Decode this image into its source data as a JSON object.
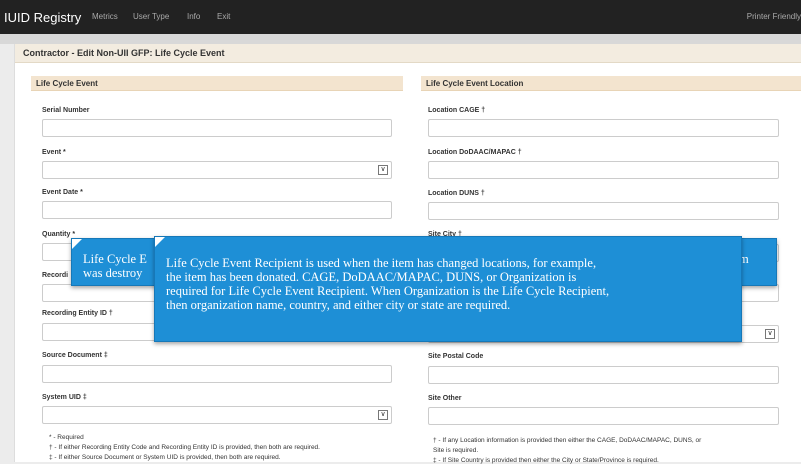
{
  "nav": {
    "brand": "IUID Registry",
    "items": [
      "Metrics",
      "User Type",
      "Info",
      "Exit"
    ],
    "printer": "Printer Friendly"
  },
  "page_title": "Contractor - Edit Non-UII GFP: Life Cycle Event",
  "left": {
    "title": "Life Cycle Event",
    "labels": {
      "serial": "Serial Number",
      "event": "Event *",
      "event_date": "Event Date *",
      "quantity": "Quantity *",
      "recording_code": "Recordi",
      "recording_id": "Recording Entity ID †",
      "source_doc": "Source Document ‡",
      "system_uid": "System UID ‡"
    },
    "notes": [
      "* - Required",
      "† - If either Recording Entity Code and Recording Entity ID is provided, then both are required.",
      "‡ - If either Source Document or System UID is provided, then both are required."
    ]
  },
  "right": {
    "title": "Life Cycle Event Location",
    "labels": {
      "cage": "Location CAGE †",
      "dodaac": "Location DoDAAC/MAPAC †",
      "duns": "Location DUNS †",
      "city": "Site City †",
      "postal": "Site Postal Code",
      "other": "Site Other"
    },
    "notes": [
      "† - If any Location information is provided then either the CAGE, DoDAAC/MAPAC, DUNS, or",
      "Site is required.",
      "‡ - If Site Country is provided then either the City or State/Province is required."
    ]
  },
  "tooltip_back": {
    "lines": [
      "Life Cycle E",
      "was destroy"
    ],
    "right_fragment": "m"
  },
  "tooltip_front": {
    "lines": [
      "Life Cycle Event Recipient is used when the item has changed locations, for example,",
      "the item has been donated. CAGE, DoDAAC/MAPAC, DUNS, or Organization is",
      "required for Life Cycle Event Recipient. When Organization is the Life Cycle Recipient,",
      "then organization name, country, and either city or state are required."
    ]
  },
  "icons": {
    "dropdown": "chevron-down-icon"
  }
}
